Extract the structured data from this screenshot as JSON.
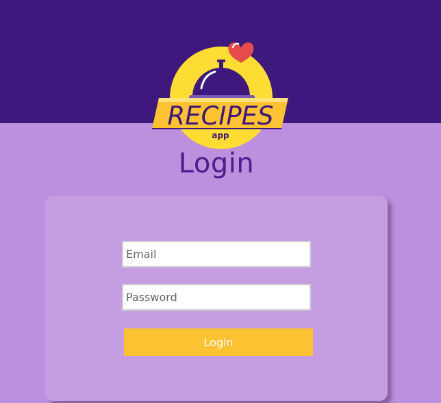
{
  "logo": {
    "brand_text": "RECIPES",
    "sub_text": "app",
    "colors": {
      "circle": "#fddd33",
      "banner": "#fdc232",
      "cloche": "#3e187c",
      "heart": "#e84b4b"
    }
  },
  "header": {
    "title": "Login"
  },
  "form": {
    "email": {
      "placeholder": "Email",
      "value": ""
    },
    "password": {
      "placeholder": "Password",
      "value": ""
    },
    "submit_label": "Login"
  },
  "colors": {
    "top_band": "#3e187c",
    "background": "#bc90dc",
    "card": "#c59ee2",
    "title": "#4a1e8c",
    "button": "#fdc232"
  }
}
